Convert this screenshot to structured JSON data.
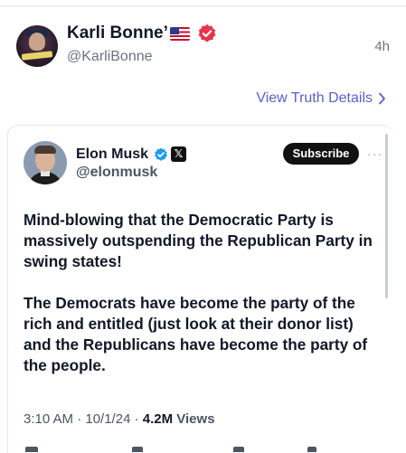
{
  "post": {
    "author_name": "Karli Bonne’",
    "author_handle": "@KarliBonne",
    "time": "4h",
    "view_details_label": "View Truth Details",
    "icons": [
      "flag-us-icon",
      "verified-badge-icon",
      "chevron-right-icon"
    ],
    "colors": {
      "verified": "#e8344b",
      "link": "#5b5fc7"
    }
  },
  "quote": {
    "author_name": "Elon Musk",
    "author_handle": "@elonmusk",
    "x_label": "𝕏",
    "subscribe_label": "Subscribe",
    "more_label": "···",
    "paragraphs": [
      "Mind-blowing that the Democratic Party is massively outspending the Republican Party in swing states!",
      "The Democrats have become the party of the rich and entitled (just look at their donor list) and the Republicans have become the party of the people."
    ],
    "meta_prefix": "3:10 AM · 10/1/24 · ",
    "views_count": "4.2M",
    "views_label": "Views",
    "colors": {
      "verified": "#1d9bf0"
    }
  }
}
